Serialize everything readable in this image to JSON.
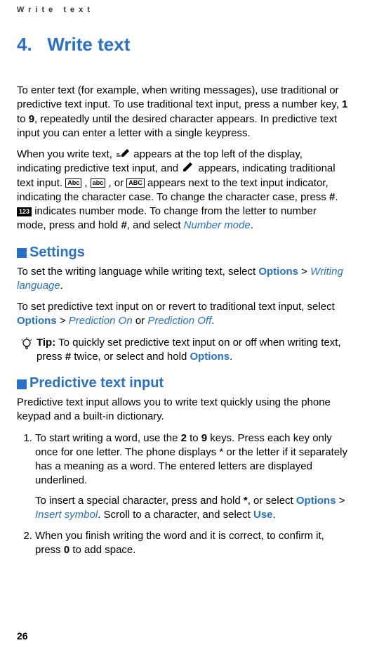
{
  "runningHead": "Write text",
  "chapter": {
    "num": "4.",
    "title": "Write text"
  },
  "intro": {
    "p1_a": "To enter text (for example, when writing messages), use traditional or predictive text input. To use traditional text input, press a number key, ",
    "p1_b": "1",
    "p1_c": " to ",
    "p1_d": "9",
    "p1_e": ", repeatedly until the desired character appears. In predictive text input you can enter a letter with a single keypress.",
    "p2_a": "When you write text, ",
    "p2_b": " appears at the top left of the display, indicating predictive text input, and ",
    "p2_c": " appears, indicating traditional text input. ",
    "p2_d": " , ",
    "p2_e": " , or ",
    "p2_f": " appears next to the text input indicator, indicating the character case. To change the character case, press ",
    "p2_g": "#",
    "p2_h": ". ",
    "p2_i": " indicates number mode. To change from the letter to number mode, press and hold ",
    "p2_j": "#",
    "p2_k": ", and select ",
    "p2_l": "Number mode",
    "p2_m": "."
  },
  "icons": {
    "predictive_pencil_alt": "predictive-input-icon",
    "traditional_pencil_alt": "traditional-input-icon",
    "abc_title": "Abc",
    "abc_lower": "abc",
    "abc_upper": "ABC",
    "num123": "123"
  },
  "settings": {
    "head": "Settings",
    "p1_a": "To set the writing language while writing text, select ",
    "p1_b": "Options",
    "p1_c": " > ",
    "p1_d": "Writing language",
    "p1_e": ".",
    "p2_a": "To set predictive text input on or revert to traditional text input, select ",
    "p2_b": "Options",
    "p2_c": " > ",
    "p2_d": "Prediction On",
    "p2_e": " or ",
    "p2_f": "Prediction Off",
    "p2_g": ".",
    "tip_label": "Tip:",
    "tip_a": " To quickly set predictive text input on or off when writing text, press ",
    "tip_b": "#",
    "tip_c": " twice, or select and hold ",
    "tip_d": "Options",
    "tip_e": "."
  },
  "predictive": {
    "head": "Predictive text input",
    "intro": "Predictive text input allows you to write text quickly using the phone keypad and a built-in dictionary.",
    "li1_a": "To start writing a word, use the ",
    "li1_b": "2",
    "li1_c": " to ",
    "li1_d": "9",
    "li1_e": " keys. Press each key only once for one letter. The phone displays * or the letter if it separately has a meaning as a word. The entered letters are displayed underlined.",
    "li1_sub_a": "To insert a special character, press and hold ",
    "li1_sub_b": "*",
    "li1_sub_c": ", or select ",
    "li1_sub_d": "Options",
    "li1_sub_e": " > ",
    "li1_sub_f": "Insert symbol",
    "li1_sub_g": ". Scroll to a character, and select ",
    "li1_sub_h": "Use",
    "li1_sub_i": ".",
    "li2_a": "When you finish writing the word and it is correct, to confirm it, press ",
    "li2_b": "0",
    "li2_c": " to add space."
  },
  "pageNumber": "26"
}
